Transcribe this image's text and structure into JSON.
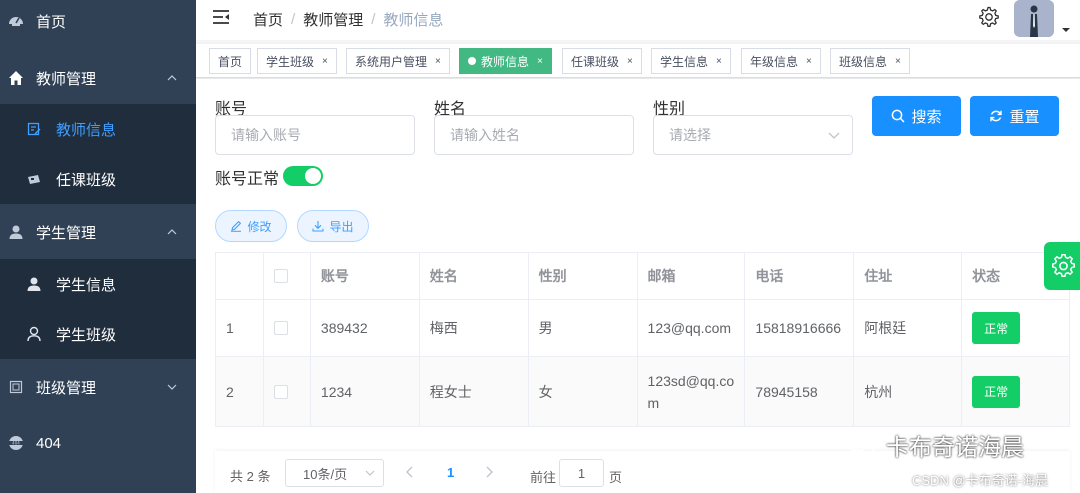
{
  "sidebar": {
    "home": "首页",
    "teacher_mgmt": "教师管理",
    "teacher_info": "教师信息",
    "teacher_class": "任课班级",
    "student_mgmt": "学生管理",
    "student_info": "学生信息",
    "student_class": "学生班级",
    "class_mgmt": "班级管理",
    "not_found": "404"
  },
  "header": {
    "breadcrumb": [
      "首页",
      "教师管理",
      "教师信息"
    ]
  },
  "tags": [
    "首页",
    "学生班级",
    "系统用户管理",
    "教师信息",
    "任课班级",
    "学生信息",
    "年级信息",
    "班级信息"
  ],
  "form": {
    "account_label": "账号",
    "account_placeholder": "请输入账号",
    "name_label": "姓名",
    "name_placeholder": "请输入姓名",
    "gender_label": "性别",
    "gender_placeholder": "请选择",
    "status_label": "账号正常",
    "status_on": true,
    "search_button": "搜索",
    "reset_button": "重置",
    "edit_button": "修改",
    "export_button": "导出"
  },
  "table": {
    "headers": [
      "账号",
      "姓名",
      "性别",
      "邮箱",
      "电话",
      "住址",
      "状态"
    ],
    "rows": [
      {
        "index": "1",
        "account": "389432",
        "name": "梅西",
        "gender": "男",
        "email": "123@qq.com",
        "phone": "15818916666",
        "address": "阿根廷",
        "status": "正常"
      },
      {
        "index": "2",
        "account": "1234",
        "name": "程女士",
        "gender": "女",
        "email": "123sd@qq.com",
        "phone": "78945158",
        "address": "杭州",
        "status": "正常"
      }
    ]
  },
  "pagination": {
    "total": "共 2 条",
    "page_size": "10条/页",
    "current_page": "1",
    "goto_label": "前往",
    "goto_value": "1",
    "page_suffix": "页"
  },
  "watermark": {
    "line1": "卡布奇诺海晨",
    "line2": "CSDN @卡布奇诺-海晨"
  },
  "colors": {
    "sidebar_bg": "#304156",
    "submenu_bg": "#1f2d3d",
    "active_link": "#409eff",
    "tag_active": "#42b983",
    "primary": "#1890ff",
    "success": "#13ce66"
  }
}
